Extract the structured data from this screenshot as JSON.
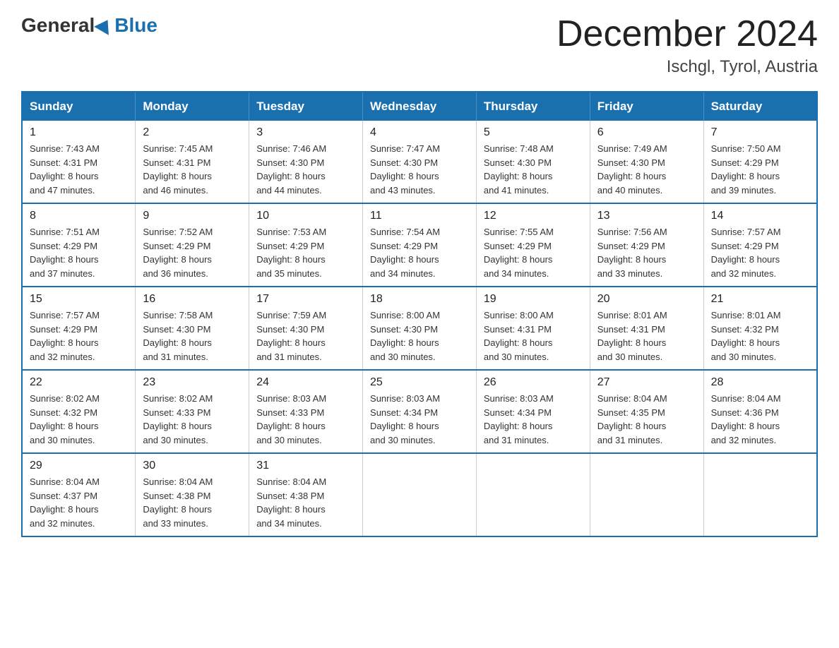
{
  "header": {
    "logo_general": "General",
    "logo_blue": "Blue",
    "month_title": "December 2024",
    "location": "Ischgl, Tyrol, Austria"
  },
  "weekdays": [
    "Sunday",
    "Monday",
    "Tuesday",
    "Wednesday",
    "Thursday",
    "Friday",
    "Saturday"
  ],
  "weeks": [
    [
      {
        "day": "1",
        "sunrise": "7:43 AM",
        "sunset": "4:31 PM",
        "daylight": "8 hours and 47 minutes."
      },
      {
        "day": "2",
        "sunrise": "7:45 AM",
        "sunset": "4:31 PM",
        "daylight": "8 hours and 46 minutes."
      },
      {
        "day": "3",
        "sunrise": "7:46 AM",
        "sunset": "4:30 PM",
        "daylight": "8 hours and 44 minutes."
      },
      {
        "day": "4",
        "sunrise": "7:47 AM",
        "sunset": "4:30 PM",
        "daylight": "8 hours and 43 minutes."
      },
      {
        "day": "5",
        "sunrise": "7:48 AM",
        "sunset": "4:30 PM",
        "daylight": "8 hours and 41 minutes."
      },
      {
        "day": "6",
        "sunrise": "7:49 AM",
        "sunset": "4:30 PM",
        "daylight": "8 hours and 40 minutes."
      },
      {
        "day": "7",
        "sunrise": "7:50 AM",
        "sunset": "4:29 PM",
        "daylight": "8 hours and 39 minutes."
      }
    ],
    [
      {
        "day": "8",
        "sunrise": "7:51 AM",
        "sunset": "4:29 PM",
        "daylight": "8 hours and 37 minutes."
      },
      {
        "day": "9",
        "sunrise": "7:52 AM",
        "sunset": "4:29 PM",
        "daylight": "8 hours and 36 minutes."
      },
      {
        "day": "10",
        "sunrise": "7:53 AM",
        "sunset": "4:29 PM",
        "daylight": "8 hours and 35 minutes."
      },
      {
        "day": "11",
        "sunrise": "7:54 AM",
        "sunset": "4:29 PM",
        "daylight": "8 hours and 34 minutes."
      },
      {
        "day": "12",
        "sunrise": "7:55 AM",
        "sunset": "4:29 PM",
        "daylight": "8 hours and 34 minutes."
      },
      {
        "day": "13",
        "sunrise": "7:56 AM",
        "sunset": "4:29 PM",
        "daylight": "8 hours and 33 minutes."
      },
      {
        "day": "14",
        "sunrise": "7:57 AM",
        "sunset": "4:29 PM",
        "daylight": "8 hours and 32 minutes."
      }
    ],
    [
      {
        "day": "15",
        "sunrise": "7:57 AM",
        "sunset": "4:29 PM",
        "daylight": "8 hours and 32 minutes."
      },
      {
        "day": "16",
        "sunrise": "7:58 AM",
        "sunset": "4:30 PM",
        "daylight": "8 hours and 31 minutes."
      },
      {
        "day": "17",
        "sunrise": "7:59 AM",
        "sunset": "4:30 PM",
        "daylight": "8 hours and 31 minutes."
      },
      {
        "day": "18",
        "sunrise": "8:00 AM",
        "sunset": "4:30 PM",
        "daylight": "8 hours and 30 minutes."
      },
      {
        "day": "19",
        "sunrise": "8:00 AM",
        "sunset": "4:31 PM",
        "daylight": "8 hours and 30 minutes."
      },
      {
        "day": "20",
        "sunrise": "8:01 AM",
        "sunset": "4:31 PM",
        "daylight": "8 hours and 30 minutes."
      },
      {
        "day": "21",
        "sunrise": "8:01 AM",
        "sunset": "4:32 PM",
        "daylight": "8 hours and 30 minutes."
      }
    ],
    [
      {
        "day": "22",
        "sunrise": "8:02 AM",
        "sunset": "4:32 PM",
        "daylight": "8 hours and 30 minutes."
      },
      {
        "day": "23",
        "sunrise": "8:02 AM",
        "sunset": "4:33 PM",
        "daylight": "8 hours and 30 minutes."
      },
      {
        "day": "24",
        "sunrise": "8:03 AM",
        "sunset": "4:33 PM",
        "daylight": "8 hours and 30 minutes."
      },
      {
        "day": "25",
        "sunrise": "8:03 AM",
        "sunset": "4:34 PM",
        "daylight": "8 hours and 30 minutes."
      },
      {
        "day": "26",
        "sunrise": "8:03 AM",
        "sunset": "4:34 PM",
        "daylight": "8 hours and 31 minutes."
      },
      {
        "day": "27",
        "sunrise": "8:04 AM",
        "sunset": "4:35 PM",
        "daylight": "8 hours and 31 minutes."
      },
      {
        "day": "28",
        "sunrise": "8:04 AM",
        "sunset": "4:36 PM",
        "daylight": "8 hours and 32 minutes."
      }
    ],
    [
      {
        "day": "29",
        "sunrise": "8:04 AM",
        "sunset": "4:37 PM",
        "daylight": "8 hours and 32 minutes."
      },
      {
        "day": "30",
        "sunrise": "8:04 AM",
        "sunset": "4:38 PM",
        "daylight": "8 hours and 33 minutes."
      },
      {
        "day": "31",
        "sunrise": "8:04 AM",
        "sunset": "4:38 PM",
        "daylight": "8 hours and 34 minutes."
      },
      null,
      null,
      null,
      null
    ]
  ],
  "labels": {
    "sunrise": "Sunrise:",
    "sunset": "Sunset:",
    "daylight": "Daylight:"
  }
}
